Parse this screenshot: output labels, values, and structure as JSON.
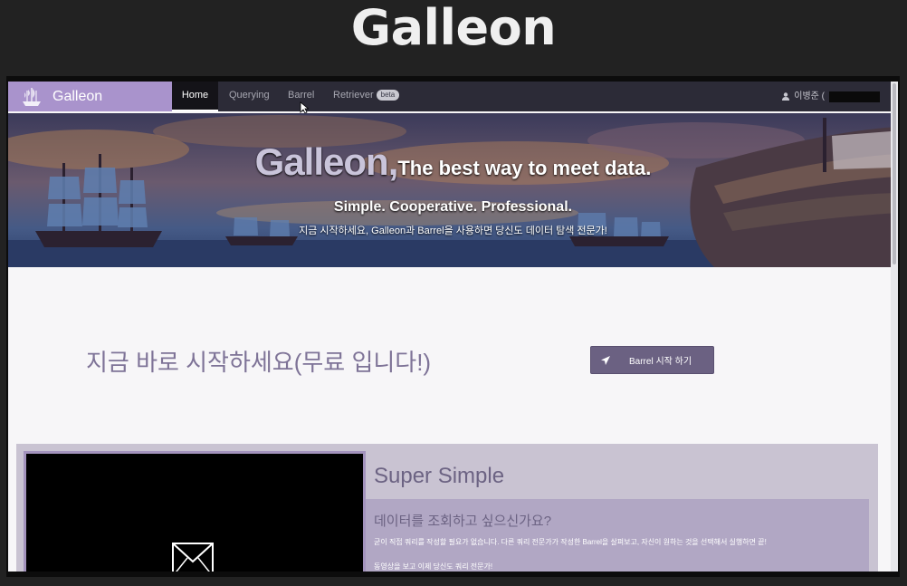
{
  "slide": {
    "title": "Galleon"
  },
  "nav": {
    "brand": "Galleon",
    "items": [
      {
        "label": "Home",
        "active": true
      },
      {
        "label": "Querying"
      },
      {
        "label": "Barrel"
      },
      {
        "label": "Retriever",
        "badge": "beta"
      }
    ],
    "user": "이병준 ("
  },
  "hero": {
    "brand_word": "Galleon,",
    "tagline": "The best way to meet data.",
    "subtitle": "Simple. Cooperative. Professional.",
    "description": "지금 시작하세요, Galleon과 Barrel을 사용하면 당신도 데이터 탐색 전문가!"
  },
  "cta": {
    "text": "지금 바로 시작하세요(무료 입니다!)",
    "button_label": "Barrel 시작 하기",
    "button_icon": "rocket-icon"
  },
  "feature": {
    "title": "Super Simple",
    "question": "데이터를 조회하고 싶으신가요?",
    "description": "굳이 직접 쿼리를 작성할 필요가 없습니다. 다른 쿼리 전문가가 작성한 Barrel을 살펴보고, 자신이 원하는 것을 선택해서 실행하면 끝!",
    "more": "동영상을 보고 이제 당신도 쿼리 전문가!"
  },
  "colors": {
    "brand": "#a993cc",
    "nav_bg": "#2c2b37",
    "accent_text": "#7e7397",
    "button": "#6b6182"
  }
}
